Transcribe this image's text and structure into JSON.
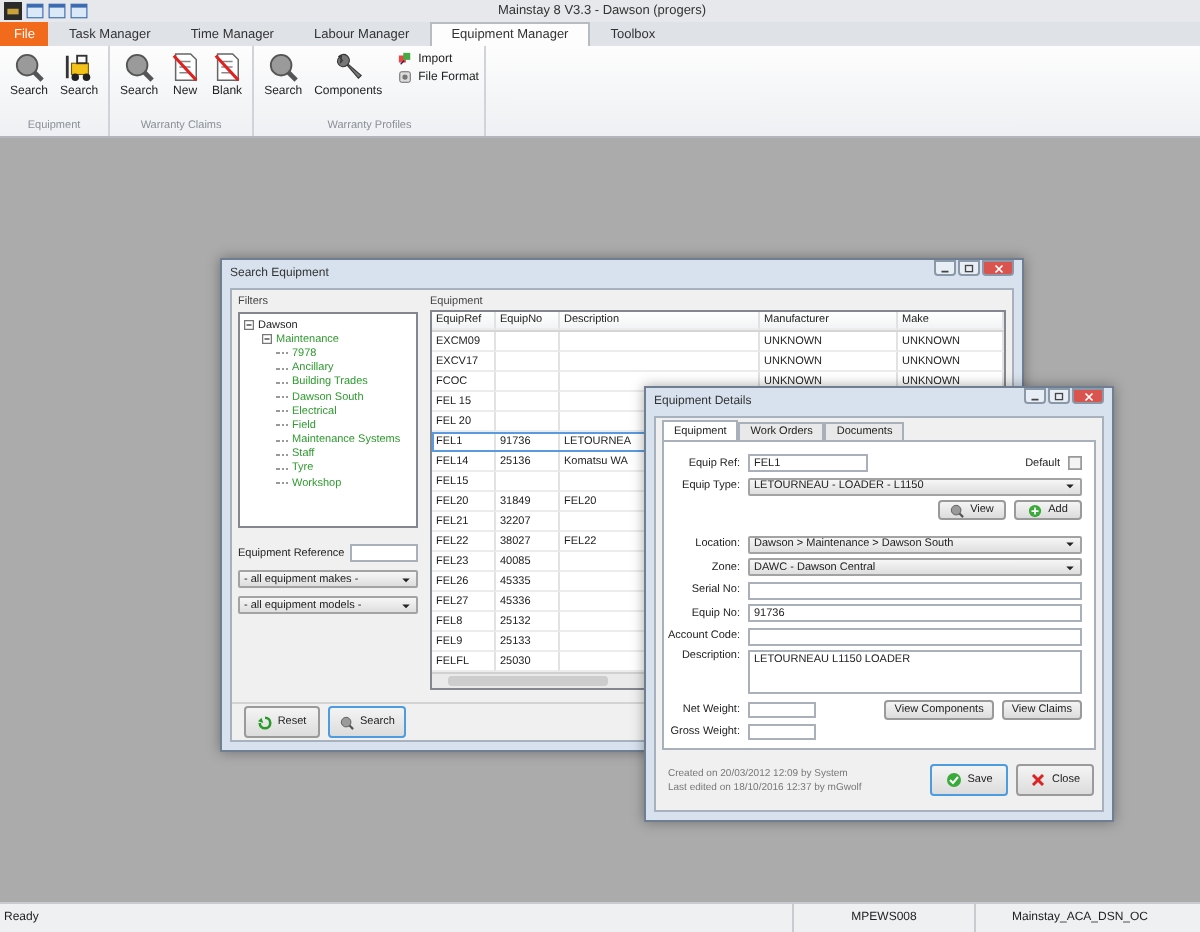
{
  "window": {
    "title": "Mainstay 8 V3.3 - Dawson (progers)"
  },
  "ribbon": {
    "tabs": [
      {
        "label": "File",
        "kind": "file",
        "selected": false
      },
      {
        "label": "Task Manager",
        "kind": "tab",
        "selected": false
      },
      {
        "label": "Time Manager",
        "kind": "tab",
        "selected": false
      },
      {
        "label": "Labour Manager",
        "kind": "tab",
        "selected": false
      },
      {
        "label": "Equipment Manager",
        "kind": "tab",
        "selected": true
      },
      {
        "label": "Toolbox",
        "kind": "tab",
        "selected": false
      }
    ],
    "groups": [
      {
        "label": "Equipment",
        "buttons": [
          {
            "label": "Search"
          },
          {
            "label": "Search"
          }
        ]
      },
      {
        "label": "Warranty Claims",
        "buttons": [
          {
            "label": "Search"
          },
          {
            "label": "New"
          },
          {
            "label": "Blank"
          }
        ]
      },
      {
        "label": "Warranty Profiles",
        "buttons": [
          {
            "label": "Search"
          },
          {
            "label": "Components"
          }
        ],
        "small_buttons": [
          {
            "label": "Import"
          },
          {
            "label": "File Format"
          }
        ]
      }
    ]
  },
  "search": {
    "title": "Search Equipment",
    "filters_label": "Filters",
    "tree": [
      {
        "label": "Dawson",
        "active": false,
        "expanded": true,
        "children": [
          {
            "label": "Maintenance",
            "active": true,
            "expanded": true,
            "children": [
              {
                "label": "7978",
                "active": true
              },
              {
                "label": "Ancillary",
                "active": true
              },
              {
                "label": "Building Trades",
                "active": true
              },
              {
                "label": "Dawson South",
                "active": true
              },
              {
                "label": "Electrical",
                "active": true
              },
              {
                "label": "Field",
                "active": true
              },
              {
                "label": "Maintenance Systems",
                "active": true
              },
              {
                "label": "Staff",
                "active": true
              },
              {
                "label": "Tyre",
                "active": true
              },
              {
                "label": "Workshop",
                "active": true
              }
            ]
          }
        ]
      }
    ],
    "reference_label": "Equipment Reference",
    "makes": "- all equipment makes -",
    "models": "- all equipment models -",
    "equipment_label": "Equipment",
    "table": {
      "columns": [
        "EquipRef",
        "EquipNo",
        "Description",
        "Manufacturer",
        "Make"
      ],
      "rows": [
        {
          "equip_ref": "EXCM09",
          "manufacturer": "UNKNOWN",
          "make": "UNKNOWN",
          "selected": false
        },
        {
          "equip_ref": "EXCV17",
          "manufacturer": "UNKNOWN",
          "make": "UNKNOWN",
          "selected": false
        },
        {
          "equip_ref": "FCOC",
          "manufacturer": "UNKNOWN",
          "make": "UNKNOWN",
          "selected": false
        },
        {
          "equip_ref": "FEL 15",
          "selected": false
        },
        {
          "equip_ref": "FEL 20",
          "selected": false
        },
        {
          "equip_ref": "FEL1",
          "equip_no": "91736",
          "description": "LETOURNEA",
          "selected": true
        },
        {
          "equip_ref": "FEL14",
          "equip_no": "25136",
          "description": "Komatsu WA",
          "selected": false
        },
        {
          "equip_ref": "FEL15",
          "selected": false
        },
        {
          "equip_ref": "FEL20",
          "equip_no": "31849",
          "description": "FEL20",
          "selected": false
        },
        {
          "equip_ref": "FEL21",
          "equip_no": "32207",
          "selected": false
        },
        {
          "equip_ref": "FEL22",
          "equip_no": "38027",
          "description": "FEL22",
          "selected": false
        },
        {
          "equip_ref": "FEL23",
          "equip_no": "40085",
          "selected": false
        },
        {
          "equip_ref": "FEL26",
          "equip_no": "45335",
          "selected": false
        },
        {
          "equip_ref": "FEL27",
          "equip_no": "45336",
          "selected": false
        },
        {
          "equip_ref": "FEL8",
          "equip_no": "25132",
          "selected": false
        },
        {
          "equip_ref": "FEL9",
          "equip_no": "25133",
          "selected": false
        },
        {
          "equip_ref": "FELFL",
          "equip_no": "25030",
          "selected": false
        }
      ]
    },
    "buttons": [
      {
        "label": "Reset"
      },
      {
        "label": "Search"
      }
    ]
  },
  "details": {
    "title": "Equipment Details",
    "tabs": [
      {
        "label": "Equipment",
        "selected": true
      },
      {
        "label": "Work Orders",
        "selected": false
      },
      {
        "label": "Documents",
        "selected": false
      }
    ],
    "equip_ref": {
      "label": "Equip Ref:",
      "value": "FEL1"
    },
    "default": {
      "label": "Default",
      "checked": false
    },
    "equip_type": {
      "label": "Equip Type:",
      "value": "LETOURNEAU  - LOADER - L1150"
    },
    "type_buttons": [
      {
        "label": "View"
      },
      {
        "label": "Add"
      }
    ],
    "fields": [
      {
        "label": "Location:",
        "kind": "combo",
        "value": "Dawson > Maintenance > Dawson South"
      },
      {
        "label": "Zone:",
        "kind": "combo",
        "value": "DAWC - Dawson Central"
      },
      {
        "label": "Serial No:",
        "kind": "text"
      },
      {
        "label": "Equip No:",
        "kind": "text",
        "value": "91736"
      },
      {
        "label": "Account Code:",
        "kind": "text"
      },
      {
        "label": "Description:",
        "kind": "textarea",
        "value": "LETOURNEAU L1150 LOADER"
      }
    ],
    "weights": [
      {
        "label": "Net Weight:"
      },
      {
        "label": "Gross Weight:"
      }
    ],
    "component_buttons": [
      {
        "label": "View Components"
      },
      {
        "label": "View Claims"
      }
    ],
    "created": "Created on 20/03/2012 12:09 by System",
    "edited": "Last edited on 18/10/2016 12:37 by mGwolf",
    "buttons": [
      {
        "label": "Save"
      },
      {
        "label": "Close"
      }
    ]
  },
  "status_bar": {
    "message": "Ready",
    "panels": [
      "MPEWS008",
      "Mainstay_ACA_DSN_OC"
    ]
  }
}
